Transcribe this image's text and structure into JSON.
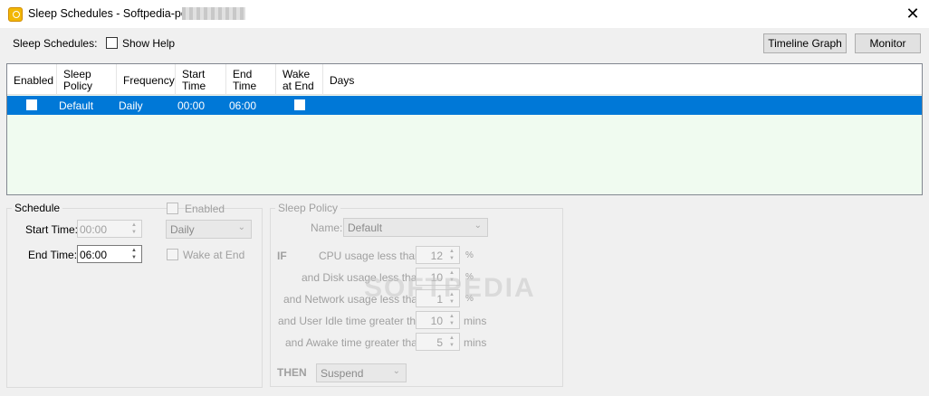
{
  "window": {
    "title": "Sleep Schedules - Softpedia-pc (",
    "close": "✕"
  },
  "toolbar": {
    "label": "Sleep Schedules:",
    "show_help": "Show Help",
    "timeline_graph": "Timeline Graph",
    "monitor": "Monitor"
  },
  "grid": {
    "columns": {
      "enabled": "Enabled",
      "sleep_policy_1": "Sleep",
      "sleep_policy_2": "Policy",
      "frequency": "Frequency",
      "start_time_1": "Start",
      "start_time_2": "Time",
      "end_time_1": "End",
      "end_time_2": "Time",
      "wake_1": "Wake",
      "wake_2": "at End",
      "days": "Days"
    },
    "rows": [
      {
        "policy": "Default",
        "frequency": "Daily",
        "start": "00:00",
        "end": "06:00",
        "days": ""
      }
    ]
  },
  "schedule": {
    "title": "Schedule",
    "start_label": "Start Time:",
    "start_value": "00:00",
    "end_label": "End Time:",
    "end_value": "06:00",
    "enabled_label": "Enabled",
    "frequency_value": "Daily",
    "wake_label": "Wake at End"
  },
  "policy": {
    "title": "Sleep Policy",
    "name_label": "Name:",
    "name_value": "Default",
    "if_label": "IF",
    "cpu_label": "CPU usage less than",
    "cpu_value": "12",
    "cpu_unit": "%",
    "disk_label": "and Disk usage less than",
    "disk_value": "10",
    "disk_unit": "%",
    "net_label": "and Network usage less than",
    "net_value": "1",
    "net_unit": "%",
    "idle_label": "and User Idle time greater than",
    "idle_value": "10",
    "idle_unit": "mins",
    "awake_label": "and Awake time greater than",
    "awake_value": "5",
    "awake_unit": "mins",
    "then_label": "THEN",
    "then_value": "Suspend"
  },
  "watermark": "SOFTPEDIA",
  "colors": {
    "selection": "#0078d7",
    "grid_bg": "#f0fbf0",
    "window_bg": "#f0f0f0"
  }
}
